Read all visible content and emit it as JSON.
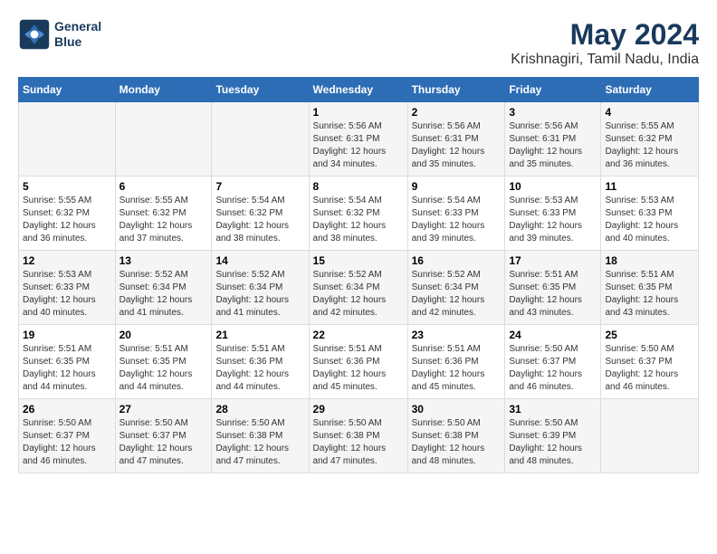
{
  "logo": {
    "line1": "General",
    "line2": "Blue"
  },
  "title": "May 2024",
  "subtitle": "Krishnagiri, Tamil Nadu, India",
  "weekdays": [
    "Sunday",
    "Monday",
    "Tuesday",
    "Wednesday",
    "Thursday",
    "Friday",
    "Saturday"
  ],
  "weeks": [
    [
      {
        "day": "",
        "sunrise": "",
        "sunset": "",
        "daylight": ""
      },
      {
        "day": "",
        "sunrise": "",
        "sunset": "",
        "daylight": ""
      },
      {
        "day": "",
        "sunrise": "",
        "sunset": "",
        "daylight": ""
      },
      {
        "day": "1",
        "sunrise": "Sunrise: 5:56 AM",
        "sunset": "Sunset: 6:31 PM",
        "daylight": "Daylight: 12 hours and 34 minutes."
      },
      {
        "day": "2",
        "sunrise": "Sunrise: 5:56 AM",
        "sunset": "Sunset: 6:31 PM",
        "daylight": "Daylight: 12 hours and 35 minutes."
      },
      {
        "day": "3",
        "sunrise": "Sunrise: 5:56 AM",
        "sunset": "Sunset: 6:31 PM",
        "daylight": "Daylight: 12 hours and 35 minutes."
      },
      {
        "day": "4",
        "sunrise": "Sunrise: 5:55 AM",
        "sunset": "Sunset: 6:32 PM",
        "daylight": "Daylight: 12 hours and 36 minutes."
      }
    ],
    [
      {
        "day": "5",
        "sunrise": "Sunrise: 5:55 AM",
        "sunset": "Sunset: 6:32 PM",
        "daylight": "Daylight: 12 hours and 36 minutes."
      },
      {
        "day": "6",
        "sunrise": "Sunrise: 5:55 AM",
        "sunset": "Sunset: 6:32 PM",
        "daylight": "Daylight: 12 hours and 37 minutes."
      },
      {
        "day": "7",
        "sunrise": "Sunrise: 5:54 AM",
        "sunset": "Sunset: 6:32 PM",
        "daylight": "Daylight: 12 hours and 38 minutes."
      },
      {
        "day": "8",
        "sunrise": "Sunrise: 5:54 AM",
        "sunset": "Sunset: 6:32 PM",
        "daylight": "Daylight: 12 hours and 38 minutes."
      },
      {
        "day": "9",
        "sunrise": "Sunrise: 5:54 AM",
        "sunset": "Sunset: 6:33 PM",
        "daylight": "Daylight: 12 hours and 39 minutes."
      },
      {
        "day": "10",
        "sunrise": "Sunrise: 5:53 AM",
        "sunset": "Sunset: 6:33 PM",
        "daylight": "Daylight: 12 hours and 39 minutes."
      },
      {
        "day": "11",
        "sunrise": "Sunrise: 5:53 AM",
        "sunset": "Sunset: 6:33 PM",
        "daylight": "Daylight: 12 hours and 40 minutes."
      }
    ],
    [
      {
        "day": "12",
        "sunrise": "Sunrise: 5:53 AM",
        "sunset": "Sunset: 6:33 PM",
        "daylight": "Daylight: 12 hours and 40 minutes."
      },
      {
        "day": "13",
        "sunrise": "Sunrise: 5:52 AM",
        "sunset": "Sunset: 6:34 PM",
        "daylight": "Daylight: 12 hours and 41 minutes."
      },
      {
        "day": "14",
        "sunrise": "Sunrise: 5:52 AM",
        "sunset": "Sunset: 6:34 PM",
        "daylight": "Daylight: 12 hours and 41 minutes."
      },
      {
        "day": "15",
        "sunrise": "Sunrise: 5:52 AM",
        "sunset": "Sunset: 6:34 PM",
        "daylight": "Daylight: 12 hours and 42 minutes."
      },
      {
        "day": "16",
        "sunrise": "Sunrise: 5:52 AM",
        "sunset": "Sunset: 6:34 PM",
        "daylight": "Daylight: 12 hours and 42 minutes."
      },
      {
        "day": "17",
        "sunrise": "Sunrise: 5:51 AM",
        "sunset": "Sunset: 6:35 PM",
        "daylight": "Daylight: 12 hours and 43 minutes."
      },
      {
        "day": "18",
        "sunrise": "Sunrise: 5:51 AM",
        "sunset": "Sunset: 6:35 PM",
        "daylight": "Daylight: 12 hours and 43 minutes."
      }
    ],
    [
      {
        "day": "19",
        "sunrise": "Sunrise: 5:51 AM",
        "sunset": "Sunset: 6:35 PM",
        "daylight": "Daylight: 12 hours and 44 minutes."
      },
      {
        "day": "20",
        "sunrise": "Sunrise: 5:51 AM",
        "sunset": "Sunset: 6:35 PM",
        "daylight": "Daylight: 12 hours and 44 minutes."
      },
      {
        "day": "21",
        "sunrise": "Sunrise: 5:51 AM",
        "sunset": "Sunset: 6:36 PM",
        "daylight": "Daylight: 12 hours and 44 minutes."
      },
      {
        "day": "22",
        "sunrise": "Sunrise: 5:51 AM",
        "sunset": "Sunset: 6:36 PM",
        "daylight": "Daylight: 12 hours and 45 minutes."
      },
      {
        "day": "23",
        "sunrise": "Sunrise: 5:51 AM",
        "sunset": "Sunset: 6:36 PM",
        "daylight": "Daylight: 12 hours and 45 minutes."
      },
      {
        "day": "24",
        "sunrise": "Sunrise: 5:50 AM",
        "sunset": "Sunset: 6:37 PM",
        "daylight": "Daylight: 12 hours and 46 minutes."
      },
      {
        "day": "25",
        "sunrise": "Sunrise: 5:50 AM",
        "sunset": "Sunset: 6:37 PM",
        "daylight": "Daylight: 12 hours and 46 minutes."
      }
    ],
    [
      {
        "day": "26",
        "sunrise": "Sunrise: 5:50 AM",
        "sunset": "Sunset: 6:37 PM",
        "daylight": "Daylight: 12 hours and 46 minutes."
      },
      {
        "day": "27",
        "sunrise": "Sunrise: 5:50 AM",
        "sunset": "Sunset: 6:37 PM",
        "daylight": "Daylight: 12 hours and 47 minutes."
      },
      {
        "day": "28",
        "sunrise": "Sunrise: 5:50 AM",
        "sunset": "Sunset: 6:38 PM",
        "daylight": "Daylight: 12 hours and 47 minutes."
      },
      {
        "day": "29",
        "sunrise": "Sunrise: 5:50 AM",
        "sunset": "Sunset: 6:38 PM",
        "daylight": "Daylight: 12 hours and 47 minutes."
      },
      {
        "day": "30",
        "sunrise": "Sunrise: 5:50 AM",
        "sunset": "Sunset: 6:38 PM",
        "daylight": "Daylight: 12 hours and 48 minutes."
      },
      {
        "day": "31",
        "sunrise": "Sunrise: 5:50 AM",
        "sunset": "Sunset: 6:39 PM",
        "daylight": "Daylight: 12 hours and 48 minutes."
      },
      {
        "day": "",
        "sunrise": "",
        "sunset": "",
        "daylight": ""
      }
    ]
  ]
}
